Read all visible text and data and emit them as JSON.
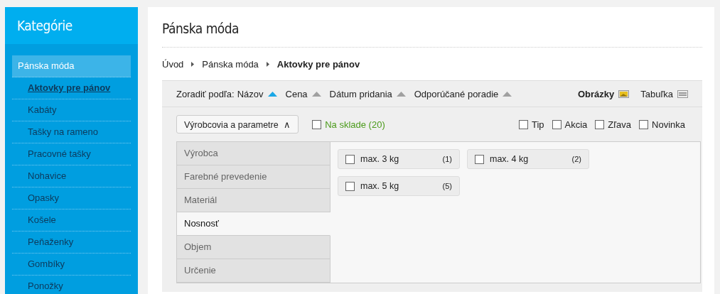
{
  "sidebar": {
    "title": "Kategórie",
    "items": [
      {
        "label": "Pánska móda",
        "selected": false,
        "children": [
          {
            "label": "Aktovky pre pánov",
            "selected": true
          },
          {
            "label": "Kabáty",
            "selected": false
          },
          {
            "label": "Tašky na rameno",
            "selected": false
          },
          {
            "label": "Pracovné tašky",
            "selected": false
          },
          {
            "label": "Nohavice",
            "selected": false
          },
          {
            "label": "Opasky",
            "selected": false
          },
          {
            "label": "Košele",
            "selected": false
          },
          {
            "label": "Peňaženky",
            "selected": false
          },
          {
            "label": "Gombíky",
            "selected": false
          },
          {
            "label": "Ponožky",
            "selected": false
          }
        ]
      }
    ]
  },
  "page_title": "Pánska móda",
  "breadcrumb": [
    "Úvod",
    "Pánska móda",
    "Aktovky pre pánov"
  ],
  "sort": {
    "label": "Zoradiť podľa:",
    "options": [
      {
        "label": "Názov",
        "selected": true
      },
      {
        "label": "Cena",
        "selected": false
      },
      {
        "label": "Dátum pridania",
        "selected": false
      },
      {
        "label": "Odporúčané poradie",
        "selected": false
      }
    ]
  },
  "views": [
    {
      "label": "Obrázky",
      "kind": "images",
      "selected": true
    },
    {
      "label": "Tabuľka",
      "kind": "table",
      "selected": false
    }
  ],
  "filter_toggle": {
    "label": "Výrobcovia a parametre",
    "expanded": true,
    "arrow": "∧"
  },
  "in_stock": {
    "label": "Na sklade (20)",
    "checked": false
  },
  "flags": [
    {
      "label": "Tip",
      "checked": false
    },
    {
      "label": "Akcia",
      "checked": false
    },
    {
      "label": "Zľava",
      "checked": false
    },
    {
      "label": "Novinka",
      "checked": false
    }
  ],
  "parameter_tabs": [
    {
      "label": "Výrobca",
      "selected": false
    },
    {
      "label": "Farebné prevedenie",
      "selected": false
    },
    {
      "label": "Materiál",
      "selected": false
    },
    {
      "label": "Nosnosť",
      "selected": true
    },
    {
      "label": "Objem",
      "selected": false
    },
    {
      "label": "Určenie",
      "selected": false
    }
  ],
  "options": [
    {
      "label": "max. 3 kg",
      "count": "(1)",
      "checked": false
    },
    {
      "label": "max. 4 kg",
      "count": "(2)",
      "checked": false
    },
    {
      "label": "max. 5 kg",
      "count": "(5)",
      "checked": false
    }
  ]
}
